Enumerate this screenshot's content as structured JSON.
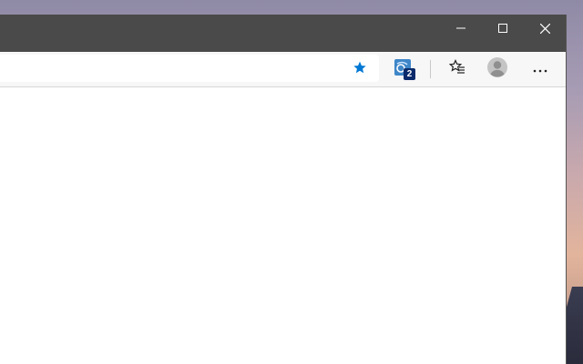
{
  "window": {
    "controls": {
      "minimize_icon": "minimize-icon",
      "maximize_icon": "maximize-icon",
      "close_icon": "close-icon"
    }
  },
  "toolbar": {
    "address_value": "",
    "favorite_star_color": "#0078d4",
    "extension": {
      "icon": "extension-icon",
      "badge": "2"
    },
    "favorites_icon": "favorites-list-icon",
    "profile_icon": "profile-avatar-icon",
    "more_icon": "more-options-icon"
  },
  "colors": {
    "titlebar": "#4a4a4a",
    "toolbar": "#f7f7f7",
    "accent": "#0078d4"
  }
}
